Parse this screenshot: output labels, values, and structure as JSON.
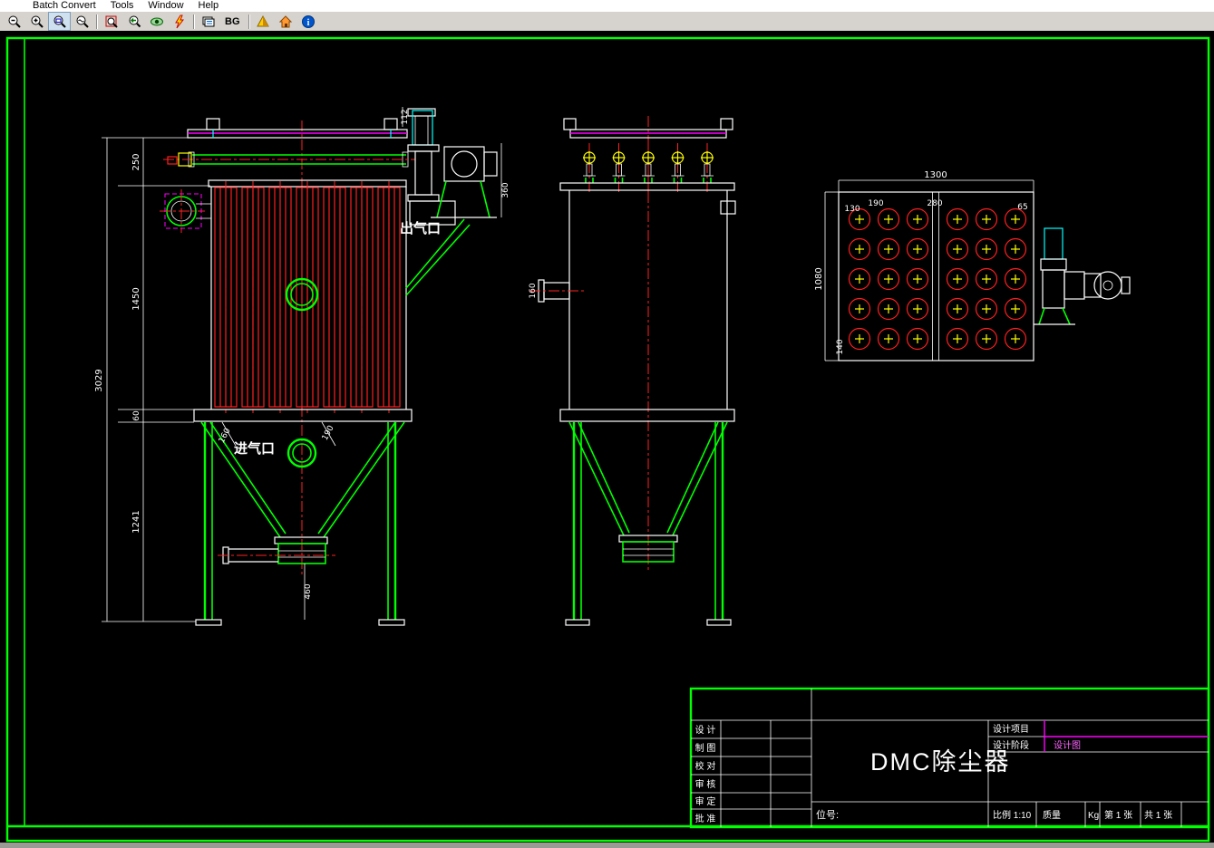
{
  "menu": {
    "items": [
      "Batch Convert",
      "Tools",
      "Window",
      "Help"
    ]
  },
  "toolbar": {
    "bg_label": "BG",
    "icons": [
      "zoom-out-icon",
      "zoom-in-icon",
      "zoom-window-icon",
      "zoom-realtime-icon",
      "zoom-extents-icon",
      "zoom-previous-icon",
      "view-3d-icon",
      "markup-icon",
      "layers-icon",
      "background-toggle",
      "render-icon",
      "home-icon",
      "about-icon"
    ],
    "active_tool": "zoom-window"
  },
  "drawing": {
    "labels": {
      "outlet": "出气口",
      "inlet": "进气口"
    },
    "dims": {
      "total_height": "3029",
      "top_section": "250",
      "bag_section": "1450",
      "flange": "60",
      "lower_section": "1241",
      "discharge_height": "460",
      "duct_width": "112",
      "fan_height": "360",
      "inlet_left": "160",
      "inlet_right": "190",
      "side_inlet": "160",
      "top_width": "1300",
      "top_height": "1080",
      "edge_130": "130",
      "pitch_190": "190",
      "center_280": "280",
      "edge_65": "65",
      "edge_140": "140"
    },
    "geometry": {
      "bags": {
        "count": 7
      },
      "valves": {
        "count": 5
      },
      "holes": {
        "rows": 5,
        "cols_per_group": 3,
        "groups": 2
      }
    },
    "colors": {
      "frame": "#00ff00",
      "bags": "#ff1f1f",
      "centerline": "#ff2222",
      "accent": "#ff00ff",
      "detail": "#00ffff",
      "valve": "#ffff00"
    }
  },
  "title_block": {
    "title": "DMC除尘器",
    "rows": [
      "设 计",
      "制 图",
      "校 对",
      "审 核",
      "审 定",
      "批 准"
    ],
    "project_label": "设计项目",
    "stage_label": "设计阶段",
    "dwg_label": "设计图",
    "tag_label": "位号:",
    "scale_label": "比例 1:10",
    "mass_label": "质量",
    "unit_label": "Kg",
    "sheet_label": "第 1 张",
    "total_label": "共 1 张"
  }
}
